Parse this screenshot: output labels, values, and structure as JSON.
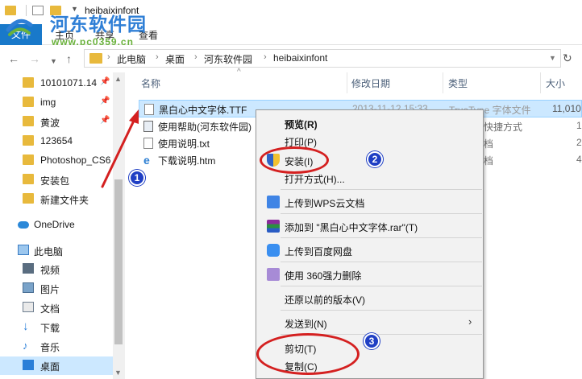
{
  "window": {
    "title": "heibaixinfont"
  },
  "watermark": {
    "name": "河东软件园",
    "url": "www.pc0359.cn"
  },
  "ribbon": {
    "tabs": [
      "文件",
      "主页",
      "共享",
      "查看"
    ]
  },
  "address": {
    "crumbs": [
      "此电脑",
      "桌面",
      "河东软件园",
      "heibaixinfont"
    ]
  },
  "nav": {
    "quick_access": [
      {
        "label": "10101071.14",
        "icon": "folder-icon",
        "pinned": true
      },
      {
        "label": "img",
        "icon": "folder-icon",
        "pinned": true
      },
      {
        "label": "黄波",
        "icon": "folder-icon",
        "pinned": true
      },
      {
        "label": "123654",
        "icon": "folder-icon",
        "pinned": false
      },
      {
        "label": "Photoshop_CS6",
        "icon": "folder-icon",
        "pinned": false
      },
      {
        "label": "安装包",
        "icon": "folder-icon",
        "pinned": false
      },
      {
        "label": "新建文件夹",
        "icon": "folder-icon",
        "pinned": false
      }
    ],
    "onedrive": "OneDrive",
    "this_pc": "此电脑",
    "pc_items": [
      {
        "label": "视频",
        "icon": "video-icon"
      },
      {
        "label": "图片",
        "icon": "picture-icon"
      },
      {
        "label": "文档",
        "icon": "document-icon"
      },
      {
        "label": "下载",
        "icon": "download-icon"
      },
      {
        "label": "音乐",
        "icon": "music-icon"
      },
      {
        "label": "桌面",
        "icon": "desktop-icon"
      }
    ]
  },
  "columns": {
    "name": "名称",
    "modified": "修改日期",
    "type": "类型",
    "size": "大小"
  },
  "files": [
    {
      "name": "黑白心中文字体.TTF",
      "date": "2013-11-12 15:33",
      "type": "TrueType 字体文件",
      "size": "11,010",
      "icon": "font-file-icon",
      "selected": true
    },
    {
      "name": "使用帮助(河东软件园)",
      "date": "",
      "type": "快捷方式",
      "size": "1",
      "icon": "shortcut-icon",
      "selected": false
    },
    {
      "name": "使用说明.txt",
      "date": "",
      "type": "档",
      "size": "2",
      "icon": "text-file-icon",
      "selected": false
    },
    {
      "name": "下载说明.htm",
      "date": "",
      "type": "文档",
      "size": "4",
      "icon": "html-file-icon",
      "selected": false
    }
  ],
  "context_menu": {
    "items": [
      {
        "label": "预览(R)",
        "bold": true,
        "icon": ""
      },
      {
        "label": "打印(P)",
        "bold": false,
        "icon": ""
      },
      {
        "label": "安装(I)",
        "bold": false,
        "icon": "shield-icon"
      },
      {
        "label": "打开方式(H)...",
        "bold": false,
        "icon": ""
      },
      {
        "label": "上传到WPS云文档",
        "bold": false,
        "icon": "wps-cloud-icon"
      },
      {
        "label": "添加到 \"黑白心中文字体.rar\"(T)",
        "bold": false,
        "icon": "winrar-icon"
      },
      {
        "label": "上传到百度网盘",
        "bold": false,
        "icon": "baidu-netdisk-icon"
      },
      {
        "label": "使用 360强力删除",
        "bold": false,
        "icon": "360-delete-icon"
      },
      {
        "label": "还原以前的版本(V)",
        "bold": false,
        "icon": ""
      },
      {
        "label": "发送到(N)",
        "bold": false,
        "icon": ""
      },
      {
        "label": "剪切(T)",
        "bold": false,
        "icon": ""
      },
      {
        "label": "复制(C)",
        "bold": false,
        "icon": ""
      }
    ]
  },
  "annotations": {
    "badges": [
      "1",
      "2",
      "3"
    ]
  },
  "colors": {
    "accent": "#1979ca",
    "selection": "#cce8ff",
    "annotation_red": "#d42020",
    "badge_blue": "#1f3fc4"
  }
}
